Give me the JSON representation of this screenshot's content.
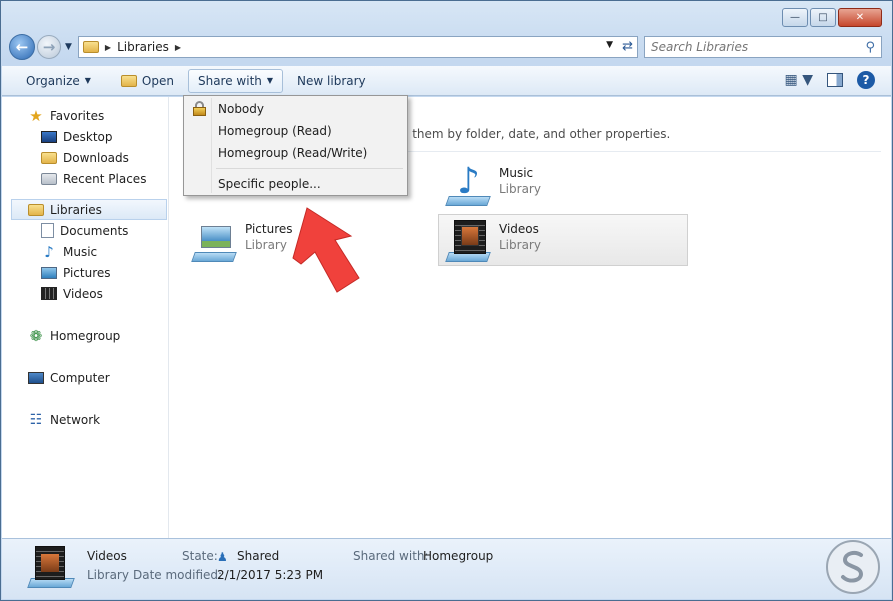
{
  "window": {
    "caption_min": "—",
    "caption_max": "□",
    "caption_close": "✕"
  },
  "address": {
    "crumb": "Libraries",
    "search_placeholder": "Search Libraries"
  },
  "toolbar": {
    "organize": "Organize",
    "open": "Open",
    "share_with": "Share with",
    "new_library": "New library"
  },
  "nav": {
    "favorites": "Favorites",
    "desktop": "Desktop",
    "downloads": "Downloads",
    "recent_places": "Recent Places",
    "libraries": "Libraries",
    "documents": "Documents",
    "music": "Music",
    "pictures": "Pictures",
    "videos": "Videos",
    "homegroup": "Homegroup",
    "computer": "Computer",
    "network": "Network"
  },
  "content": {
    "description_fragment": "e them by folder, date, and other properties.",
    "tiles": [
      {
        "name": "Music",
        "sub": "Library"
      },
      {
        "name": "Pictures",
        "sub": "Library"
      },
      {
        "name": "Videos",
        "sub": "Library"
      }
    ]
  },
  "share_menu": {
    "nobody": "Nobody",
    "homegroup_read": "Homegroup (Read)",
    "homegroup_read_write": "Homegroup (Read/Write)",
    "specific_people": "Specific people..."
  },
  "details": {
    "name": "Videos",
    "type": "Library",
    "state_label": "State:",
    "state_value": "Shared",
    "modified_label": "Date modified:",
    "modified_value": "2/1/2017 5:23 PM",
    "shared_with_label": "Shared with:",
    "shared_with_value": "Homegroup"
  },
  "colors": {
    "accent": "#1c5aa6",
    "arrow": "#f0413c"
  }
}
